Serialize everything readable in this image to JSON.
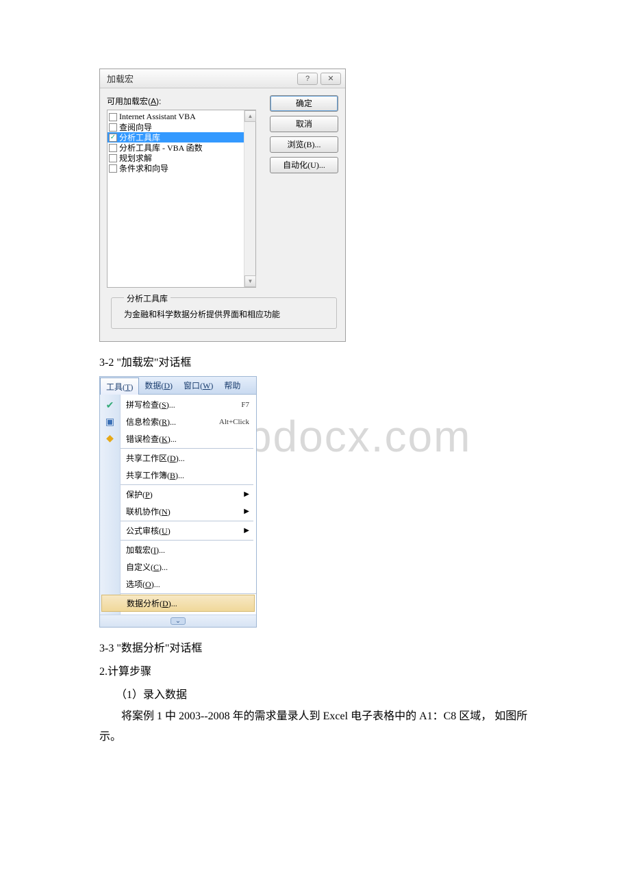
{
  "watermark": "www.bdocx.com",
  "dialog1": {
    "title": "加载宏",
    "label_available": "可用加载宏(",
    "label_available_key": "A",
    "label_available_end": "):",
    "items": [
      {
        "label": "Internet Assistant VBA",
        "checked": false,
        "selected": false
      },
      {
        "label": "查阅向导",
        "checked": false,
        "selected": false
      },
      {
        "label": "分析工具库",
        "checked": true,
        "selected": true
      },
      {
        "label": "分析工具库 - VBA 函数",
        "checked": false,
        "selected": false
      },
      {
        "label": "规划求解",
        "checked": false,
        "selected": false
      },
      {
        "label": "条件求和向导",
        "checked": false,
        "selected": false
      }
    ],
    "buttons": {
      "ok": "确定",
      "cancel": "取消",
      "browse": "浏览(B)...",
      "automation": "自动化(U)..."
    },
    "footer_title": "分析工具库",
    "footer_desc": "为金融和科学数据分析提供界面和相应功能"
  },
  "caption1": "3-2 \"加载宏\"对话框",
  "menu": {
    "header": [
      {
        "label": "工具",
        "key": "T",
        "active": true
      },
      {
        "label": "数据",
        "key": "D",
        "active": false
      },
      {
        "label": "窗口",
        "key": "W",
        "active": false
      },
      {
        "label": "帮助",
        "key": "",
        "active": false,
        "partial": true
      }
    ],
    "items": [
      {
        "label": "拼写检查",
        "key": "S",
        "suffix": "...",
        "shortcut": "F7",
        "icon": "spellcheck-icon",
        "glyph": "✔"
      },
      {
        "label": "信息检索",
        "key": "R",
        "suffix": "...",
        "shortcut": "Alt+Click",
        "icon": "research-icon",
        "glyph": "📘"
      },
      {
        "label": "错误检查",
        "key": "K",
        "suffix": "...",
        "shortcut": "",
        "icon": "error-icon",
        "glyph": "◆",
        "sep_after": true
      },
      {
        "label": "共享工作区",
        "key": "D",
        "suffix": "...",
        "shortcut": ""
      },
      {
        "label": "共享工作簿",
        "key": "B",
        "suffix": "...",
        "shortcut": "",
        "sep_after": true
      },
      {
        "label": "保护",
        "key": "P",
        "suffix": "",
        "submenu": true
      },
      {
        "label": "联机协作",
        "key": "N",
        "suffix": "",
        "submenu": true,
        "sep_after": true
      },
      {
        "label": "公式审核",
        "key": "U",
        "suffix": "",
        "submenu": true,
        "sep_after": true
      },
      {
        "label": "加载宏",
        "key": "I",
        "suffix": "...",
        "shortcut": ""
      },
      {
        "label": "自定义",
        "key": "C",
        "suffix": "...",
        "shortcut": ""
      },
      {
        "label": "选项",
        "key": "O",
        "suffix": "...",
        "shortcut": "",
        "sep_after": true
      },
      {
        "label": "数据分析",
        "key": "D",
        "suffix": "...",
        "shortcut": "",
        "highlighted": true
      }
    ]
  },
  "caption2": "3-3 \"数据分析\"对话框",
  "para1": "2.计算步骤",
  "para2": "（1）录入数据",
  "para3": "将案例 1 中 2003--2008 年的需求量录人到 Excel 电子表格中的 A1：C8 区域， 如图所示。"
}
